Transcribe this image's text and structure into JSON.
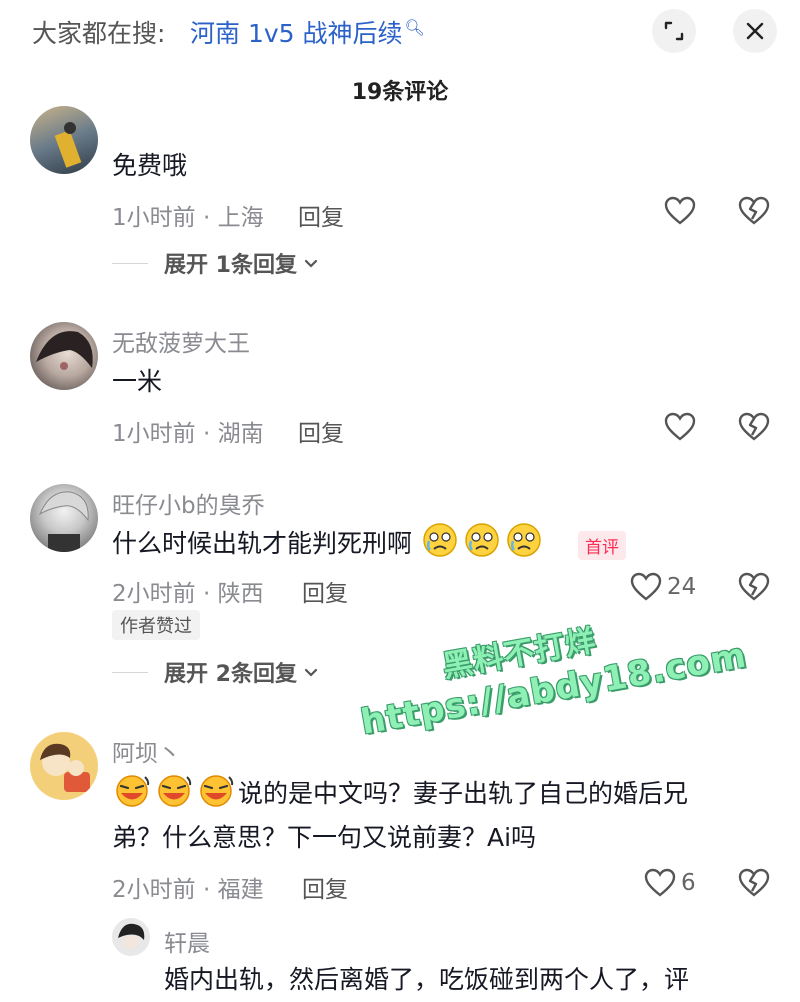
{
  "header": {
    "search_prefix": "大家都在搜:",
    "search_term": "河南 1v5 战神后续",
    "title": "19条评论"
  },
  "comments": [
    {
      "username": "",
      "text": "免费哦",
      "time_location": "1小时前 · 上海",
      "reply_label": "回复",
      "expand_label": "展开 1条回复"
    },
    {
      "username": "无敌菠萝大王",
      "text": "一米",
      "time_location": "1小时前 · 湖南",
      "reply_label": "回复"
    },
    {
      "username": "旺仔小b的臭乔",
      "text": "什么时候出轨才能判死刑啊",
      "emoji_count": 3,
      "first_tag": "首评",
      "time_location": "2小时前 · 陕西",
      "reply_label": "回复",
      "like_count": "24",
      "author_liked": "作者赞过",
      "expand_label": "展开 2条回复"
    },
    {
      "username": "阿坝丶",
      "text_line1": "说的是中文吗？妻子出轨了自己的婚后兄",
      "text_line2": "弟？什么意思？下一句又说前妻？Ai吗",
      "emoji_count": 3,
      "time_location": "2小时前 · 福建",
      "reply_label": "回复",
      "like_count": "6"
    },
    {
      "username": "轩晨",
      "text": "婚内出轨，然后离婚了，吃饭碰到两个人了，评"
    }
  ],
  "watermark": {
    "line1": "黑料不打烊",
    "line2": "https://abdy18.com"
  },
  "colors": {
    "accent_link": "#2a62c9",
    "first_tag": "#fe2c55",
    "watermark": "#8ef0b4"
  }
}
